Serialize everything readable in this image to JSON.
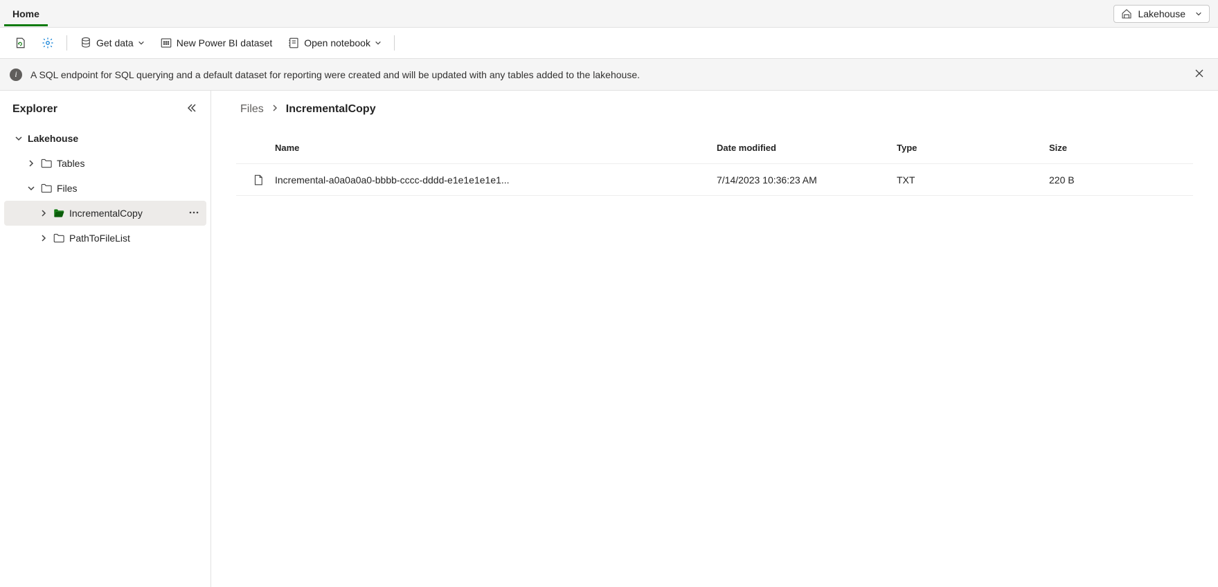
{
  "header": {
    "home_tab": "Home",
    "lakehouse_label": "Lakehouse"
  },
  "toolbar": {
    "get_data": "Get data",
    "new_dataset": "New Power BI dataset",
    "open_notebook": "Open notebook"
  },
  "info_bar": {
    "message": "A SQL endpoint for SQL querying and a default dataset for reporting were created and will be updated with any tables added to the lakehouse."
  },
  "explorer": {
    "title": "Explorer",
    "root": "Lakehouse",
    "nodes": {
      "tables": "Tables",
      "files": "Files",
      "incremental": "IncrementalCopy",
      "pathlist": "PathToFileList"
    }
  },
  "breadcrumb": {
    "parent": "Files",
    "current": "IncrementalCopy"
  },
  "table": {
    "headers": {
      "name": "Name",
      "modified": "Date modified",
      "type": "Type",
      "size": "Size"
    },
    "rows": [
      {
        "name": "Incremental-a0a0a0a0-bbbb-cccc-dddd-e1e1e1e1e1...",
        "modified": "7/14/2023 10:36:23 AM",
        "type": "TXT",
        "size": "220 B"
      }
    ]
  }
}
